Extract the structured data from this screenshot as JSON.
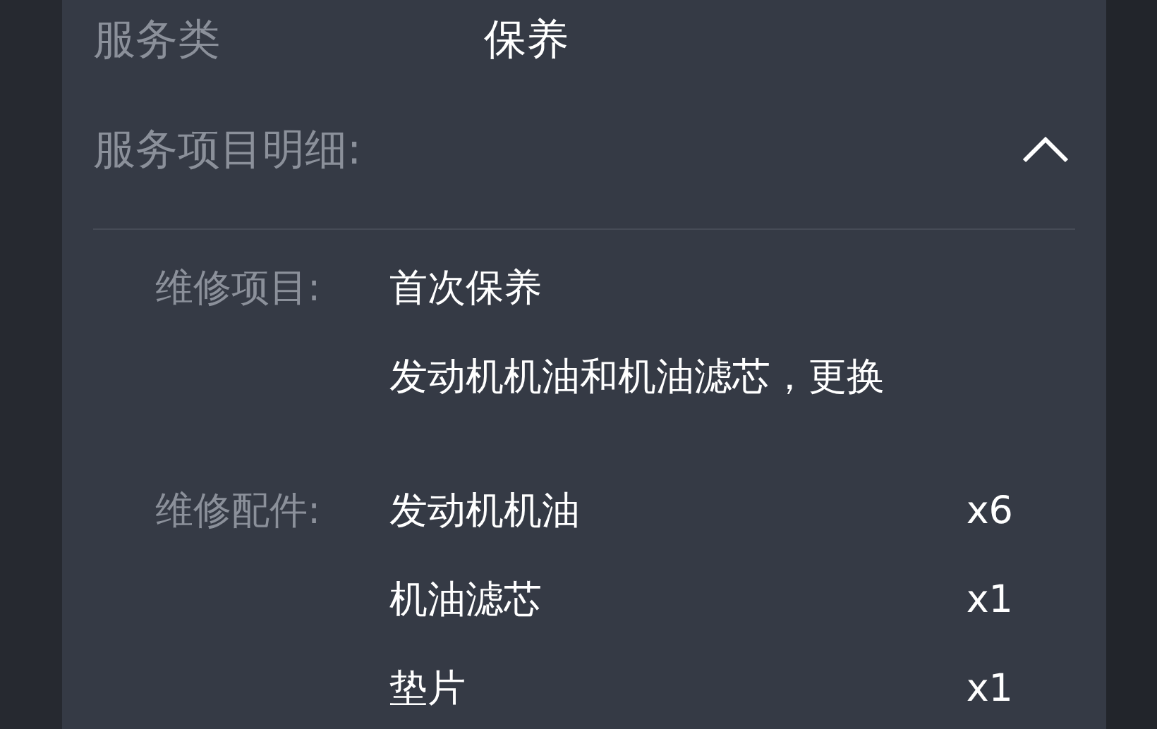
{
  "service_type": {
    "label": "服务类",
    "value": "保养"
  },
  "details": {
    "label": "服务项目明细:",
    "expanded": true,
    "items": {
      "label": "维修项目:",
      "values": [
        "首次保养",
        "发动机机油和机油滤芯，更换"
      ]
    },
    "parts": {
      "label": "维修配件:",
      "rows": [
        {
          "name": "发动机机油",
          "qty": "x6"
        },
        {
          "name": "机油滤芯",
          "qty": "x1"
        },
        {
          "name": "垫片",
          "qty": "x1"
        }
      ]
    }
  }
}
